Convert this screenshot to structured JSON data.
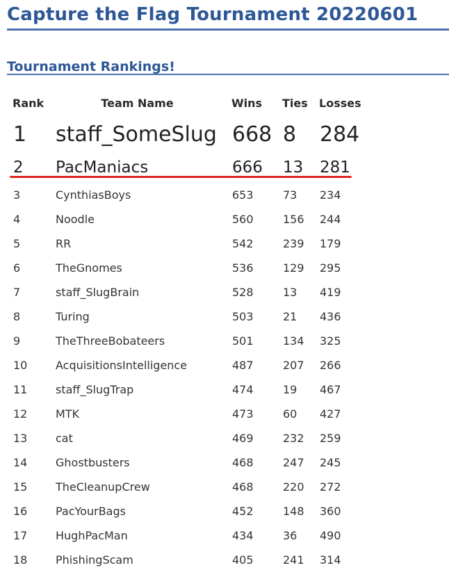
{
  "page": {
    "title": "Capture the Flag Tournament 20220601",
    "section_title": "Tournament Rankings!"
  },
  "colors": {
    "heading": "#2e5796",
    "rule": "#4a72b0",
    "highlight_underline": "#e02424"
  },
  "table": {
    "headers": {
      "rank": "Rank",
      "team": "Team Name",
      "wins": "Wins",
      "ties": "Ties",
      "losses": "Losses"
    },
    "rows": [
      {
        "rank": "1",
        "team": "staff_SomeSlug",
        "wins": "668",
        "ties": "8",
        "losses": "284"
      },
      {
        "rank": "2",
        "team": "PacManiacs",
        "wins": "666",
        "ties": "13",
        "losses": "281"
      },
      {
        "rank": "3",
        "team": "CynthiasBoys",
        "wins": "653",
        "ties": "73",
        "losses": "234"
      },
      {
        "rank": "4",
        "team": "Noodle",
        "wins": "560",
        "ties": "156",
        "losses": "244"
      },
      {
        "rank": "5",
        "team": "RR",
        "wins": "542",
        "ties": "239",
        "losses": "179"
      },
      {
        "rank": "6",
        "team": "TheGnomes",
        "wins": "536",
        "ties": "129",
        "losses": "295"
      },
      {
        "rank": "7",
        "team": "staff_SlugBrain",
        "wins": "528",
        "ties": "13",
        "losses": "419"
      },
      {
        "rank": "8",
        "team": "Turing",
        "wins": "503",
        "ties": "21",
        "losses": "436"
      },
      {
        "rank": "9",
        "team": "TheThreeBobateers",
        "wins": "501",
        "ties": "134",
        "losses": "325"
      },
      {
        "rank": "10",
        "team": "AcquisitionsIntelligence",
        "wins": "487",
        "ties": "207",
        "losses": "266"
      },
      {
        "rank": "11",
        "team": "staff_SlugTrap",
        "wins": "474",
        "ties": "19",
        "losses": "467"
      },
      {
        "rank": "12",
        "team": "MTK",
        "wins": "473",
        "ties": "60",
        "losses": "427"
      },
      {
        "rank": "13",
        "team": "cat",
        "wins": "469",
        "ties": "232",
        "losses": "259"
      },
      {
        "rank": "14",
        "team": "Ghostbusters",
        "wins": "468",
        "ties": "247",
        "losses": "245"
      },
      {
        "rank": "15",
        "team": "TheCleanupCrew",
        "wins": "468",
        "ties": "220",
        "losses": "272"
      },
      {
        "rank": "16",
        "team": "PacYourBags",
        "wins": "452",
        "ties": "148",
        "losses": "360"
      },
      {
        "rank": "17",
        "team": "HughPacMan",
        "wins": "434",
        "ties": "36",
        "losses": "490"
      },
      {
        "rank": "18",
        "team": "PhishingScam",
        "wins": "405",
        "ties": "241",
        "losses": "314"
      }
    ]
  }
}
